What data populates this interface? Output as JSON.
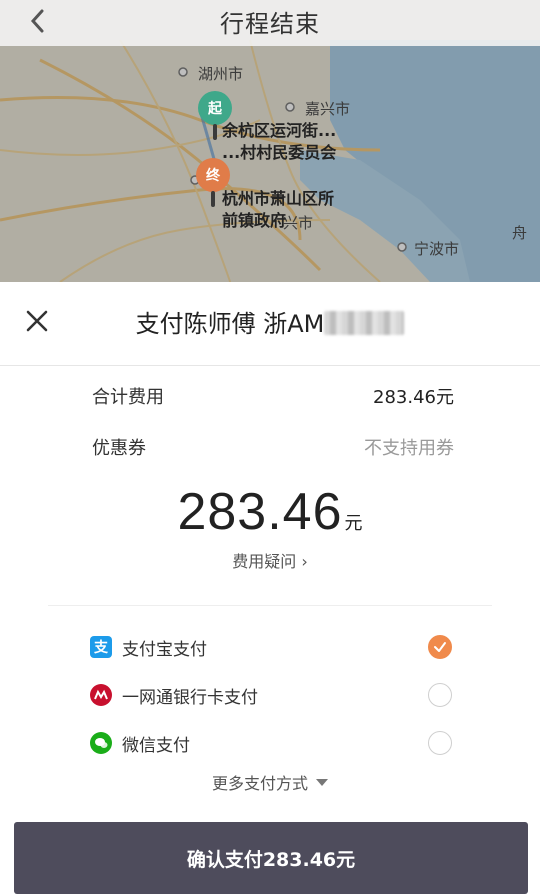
{
  "header": {
    "title": "行程结束"
  },
  "map": {
    "labels": {
      "huzhou": "湖州市",
      "jiaxing": "嘉兴市",
      "ningbo": "宁波市",
      "xing": "兴市",
      "zhou": "舟"
    },
    "start_pin": "起",
    "end_pin": "终",
    "start_address_line1": "余杭区运河街...",
    "start_address_line2": "...村村民委员会",
    "end_address_line1": "杭州市萧山区所",
    "end_address_line2": "前镇政府"
  },
  "sheet": {
    "title": "支付陈师傅 浙AM",
    "fee_label": "合计费用",
    "fee_value": "283.46元",
    "coupon_label": "优惠券",
    "coupon_value": "不支持用券",
    "amount": "283.46",
    "amount_unit": "元",
    "fee_question": "费用疑问 ›",
    "payment_methods": [
      {
        "label": "支付宝支付",
        "icon": "alipay-icon",
        "color": "#1c9bea",
        "selected": true
      },
      {
        "label": "一网通银行卡支付",
        "icon": "cmb-icon",
        "color": "#c8102e",
        "selected": false
      },
      {
        "label": "微信支付",
        "icon": "wechat-icon",
        "color": "#1aad19",
        "selected": false
      }
    ],
    "more_methods": "更多支付方式",
    "confirm_button": "确认支付283.46元"
  },
  "colors": {
    "accent": "#f08a4b",
    "button": "#4e4c5c",
    "start_pin": "#3fa88a",
    "end_pin": "#e07c49"
  }
}
